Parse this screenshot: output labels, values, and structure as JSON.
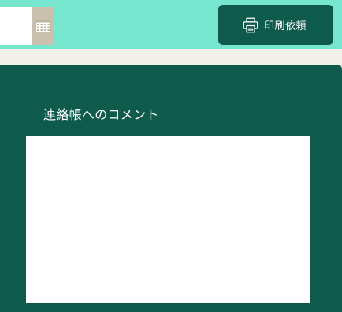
{
  "header": {
    "background": "#76e6cf",
    "date_input": {
      "value": "",
      "placeholder": ""
    },
    "calendar_button": {
      "icon": "calendar-icon",
      "color": "#c9c1ad"
    },
    "print_button": {
      "label": "印刷依頼",
      "icon": "printer-icon",
      "color": "#0e5a4b"
    }
  },
  "panel": {
    "background": "#0e5a4b",
    "comment_title": "連絡帳へのコメント",
    "comment_value": ""
  }
}
